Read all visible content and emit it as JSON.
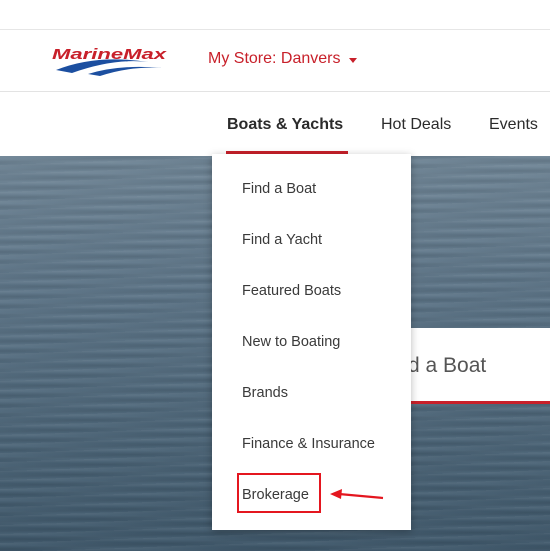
{
  "header": {
    "logo_text": "MarineMax",
    "store_label": "My Store: Danvers"
  },
  "nav": {
    "items": [
      {
        "label": "Boats & Yachts",
        "active": true
      },
      {
        "label": "Hot Deals",
        "active": false
      },
      {
        "label": "Events",
        "active": false
      }
    ]
  },
  "dropdown": {
    "items": [
      {
        "label": "Find a Boat"
      },
      {
        "label": "Find a Yacht"
      },
      {
        "label": "Featured Boats"
      },
      {
        "label": "New to Boating"
      },
      {
        "label": "Brands"
      },
      {
        "label": "Finance & Insurance"
      },
      {
        "label": "Brokerage",
        "annotated": true
      }
    ]
  },
  "hero": {
    "find_text": "d a Boat"
  },
  "colors": {
    "brand_red": "#c8202a",
    "logo_blue": "#1c4fa0",
    "annotation_red": "#e4161f"
  }
}
